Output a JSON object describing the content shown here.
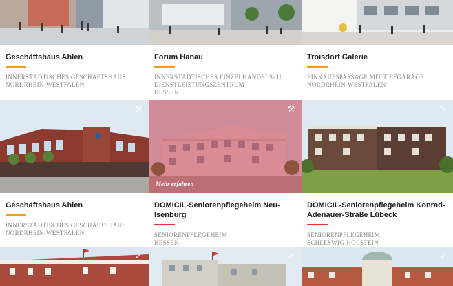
{
  "colors": {
    "accent_orange": "#f29a1d",
    "accent_red": "#e2362f",
    "title_text": "#222222",
    "meta_text": "#8b8b8b",
    "hover_overlay": "#be283c"
  },
  "projects": [
    {
      "title": "Geschäftshaus Ahlen",
      "meta": [
        "INNERSTÄDTISCHES GESCHÄFTSHAUS",
        "NORDRHEIN-WESTFALEN"
      ],
      "accent": "orange",
      "icon": ""
    },
    {
      "title": "Forum Hanau",
      "meta": [
        "INNERSTÄDTISCHES EINZELHANDELS- U.",
        "DIENSTLEISTUNGSZENTRUM",
        "HESSEN"
      ],
      "accent": "orange",
      "icon": ""
    },
    {
      "title": "Troisdorf Galerie",
      "meta": [
        "EINKAUFSPASSAGE MIT TIEFGARAGE",
        "NORDRHEIN-WESTFALEN"
      ],
      "accent": "orange",
      "icon": ""
    },
    {
      "title": "Geschäftshaus Ahlen",
      "meta": [
        "INNERSTÄDTISCHES GESCHÄFTSHAUS",
        "NORDRHEIN-WESTFALEN"
      ],
      "accent": "orange",
      "icon": "hammer-icon"
    },
    {
      "title": "DOMICIL-Seniorenpflegeheim Neu-Isenburg",
      "meta": [
        "SENIORENPFLEGEHEIM",
        "HESSEN"
      ],
      "accent": "red",
      "icon": "hammer-icon",
      "hover_label": "Mehr erfahren"
    },
    {
      "title": "DOMICIL-Seniorenpflegeheim Konrad-Adenauer-Straße Lübeck",
      "meta": [
        "SENIORENPFLEGEHEIM",
        "SCHLESWIG-HOLSTEIN"
      ],
      "accent": "red",
      "icon": "pencil-icon"
    },
    {
      "title": "",
      "meta": [],
      "accent": "",
      "icon": "check-icon"
    },
    {
      "title": "",
      "meta": [],
      "accent": "",
      "icon": "check-icon"
    },
    {
      "title": "",
      "meta": [],
      "accent": "",
      "icon": "check-icon"
    }
  ]
}
